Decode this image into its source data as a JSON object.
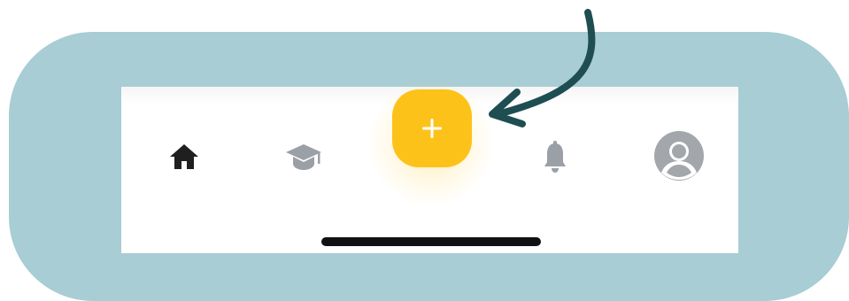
{
  "colors": {
    "frame_background": "#a8cdd4",
    "screen_background": "#ffffff",
    "accent_add_button": "#fdc21a",
    "active_icon": "#1f1f1f",
    "inactive_icon": "#9aa0a6",
    "annotation_arrow": "#1f4e52",
    "home_indicator": "#111111"
  },
  "tab_bar": {
    "items": [
      {
        "icon": "home-icon",
        "state": "active"
      },
      {
        "icon": "graduation-cap-icon",
        "state": "inactive"
      },
      {
        "icon": "plus-icon",
        "state": "highlighted"
      },
      {
        "icon": "bell-icon",
        "state": "inactive"
      },
      {
        "icon": "user-avatar-icon",
        "state": "inactive"
      }
    ]
  },
  "annotation": {
    "icon": "curved-arrow-icon",
    "points_to": "add-button"
  }
}
